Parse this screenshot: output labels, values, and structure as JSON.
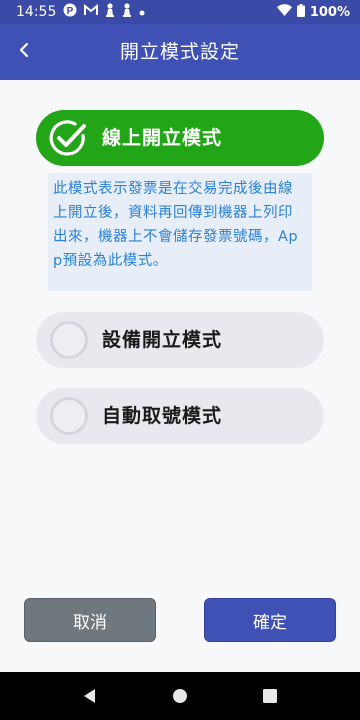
{
  "status_bar": {
    "time": "14:55",
    "battery": "100%",
    "icons": [
      "p-notification-icon",
      "gmail-icon",
      "pawn-icon",
      "pawn-icon",
      "dot-icon",
      "wifi-icon",
      "battery-icon"
    ]
  },
  "app_bar": {
    "title": "開立模式設定",
    "back_icon": "chevron-left-icon"
  },
  "options": [
    {
      "label": "線上開立模式",
      "selected": true
    },
    {
      "label": "設備開立模式",
      "selected": false
    },
    {
      "label": "自動取號模式",
      "selected": false
    }
  ],
  "description": "此模式表示發票是在交易完成後由線上開立後，資料再回傳到機器上列印出來，機器上不會儲存發票號碼，App預設為此模式。",
  "buttons": {
    "cancel": "取消",
    "confirm": "確定"
  },
  "colors": {
    "primary": "#3f51b5",
    "selected_green": "#22a617",
    "description_text": "#2b82d4",
    "cancel_gray": "#6f777f"
  },
  "nav_bar": [
    "back-triangle-icon",
    "home-circle-icon",
    "recents-square-icon"
  ]
}
